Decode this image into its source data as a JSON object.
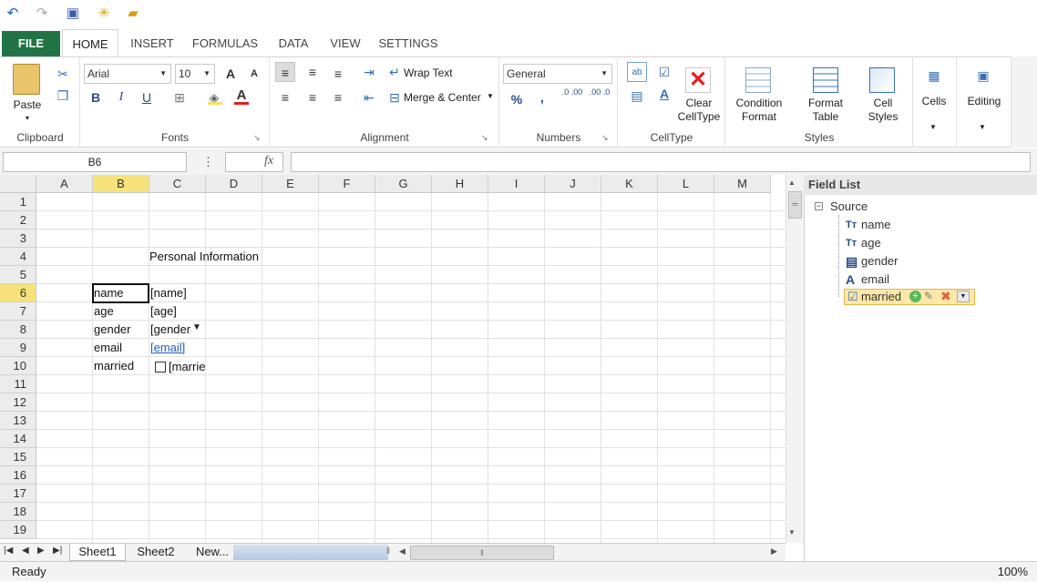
{
  "qat": {
    "undo_icon": "undo-icon",
    "redo_icon": "redo-icon",
    "save_icon": "save-icon",
    "new_icon": "new-icon",
    "open_icon": "open-icon"
  },
  "tabs": {
    "file": "FILE",
    "home": "HOME",
    "insert": "INSERT",
    "formulas": "FORMULAS",
    "data": "DATA",
    "view": "VIEW",
    "settings": "SETTINGS"
  },
  "ribbon": {
    "clipboard": {
      "label": "Clipboard",
      "paste": "Paste"
    },
    "fonts": {
      "label": "Fonts",
      "font": "Arial",
      "size": "10",
      "bold": "B",
      "italic": "I",
      "underline": "U",
      "grow": "A",
      "shrink": "A",
      "fontcolor": "A"
    },
    "alignment": {
      "label": "Alignment",
      "wrap": "Wrap Text",
      "merge": "Merge & Center"
    },
    "numbers": {
      "label": "Numbers",
      "format": "General",
      "percent": "%",
      "comma": ",",
      "inc": ".0 .00",
      "dec": ".00 .0"
    },
    "celltype": {
      "label": "CellType",
      "clear1": "Clear",
      "clear2": "CellType"
    },
    "styles": {
      "label": "Styles",
      "cond1": "Condition",
      "cond2": "Format",
      "fmt1": "Format",
      "fmt2": "Table",
      "cell1": "Cell",
      "cell2": "Styles"
    },
    "cells": "Cells",
    "editing": "Editing"
  },
  "formula": {
    "namebox": "B6",
    "dots": "⋮",
    "fx": "fx",
    "value": ""
  },
  "columns": [
    "A",
    "B",
    "C",
    "D",
    "E",
    "F",
    "G",
    "H",
    "I",
    "J",
    "K",
    "L",
    "M"
  ],
  "rows": [
    "1",
    "2",
    "3",
    "4",
    "5",
    "6",
    "7",
    "8",
    "9",
    "10",
    "11",
    "12",
    "13",
    "14",
    "15",
    "16",
    "17",
    "18",
    "19"
  ],
  "cells": {
    "c4": "Personal Information",
    "b6": "name",
    "c6": "[name]",
    "b7": "age",
    "c7": "[age]",
    "b8": "gender",
    "c8": "[gender",
    "b9": "email",
    "c9": "[email]",
    "b10": "married",
    "c10": "[married]"
  },
  "fieldlist": {
    "title": "Field List",
    "source": "Source",
    "items": [
      {
        "label": "name",
        "icon": "text-field-icon"
      },
      {
        "label": "age",
        "icon": "text-field-icon"
      },
      {
        "label": "gender",
        "icon": "combobox-icon"
      },
      {
        "label": "email",
        "icon": "hyperlink-icon"
      },
      {
        "label": "married",
        "icon": "checkbox-icon"
      }
    ]
  },
  "sheets": [
    "Sheet1",
    "Sheet2",
    "New..."
  ],
  "status": {
    "left": "Ready",
    "zoom": "100%"
  },
  "colors": {
    "file_tab": "#217346",
    "selected_header": "#f6e27a",
    "link": "#1f5fb4",
    "field_highlight": "#fde8a8"
  }
}
